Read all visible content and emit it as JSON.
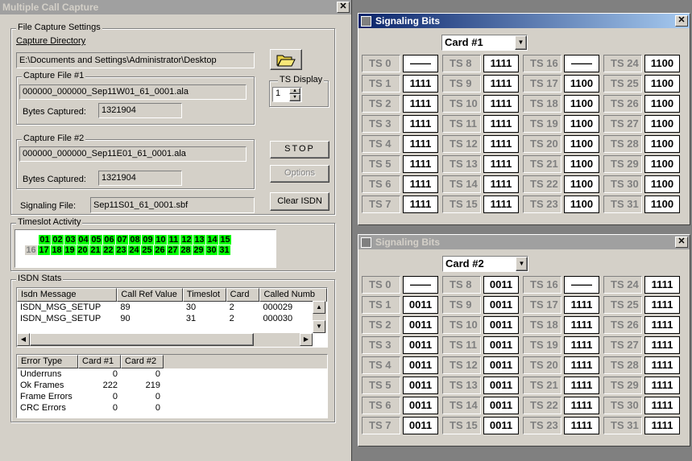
{
  "main": {
    "title": "Multiple Call Capture",
    "file_capture_settings": "File Capture Settings",
    "capture_directory_label": "Capture Directory",
    "capture_directory": "E:\\Documents and Settings\\Administrator\\Desktop",
    "file1_group": "Capture File #1",
    "file1": "000000_000000_Sep11W01_61_0001.ala",
    "bytes_label": "Bytes Captured:",
    "file1_bytes": "1321904",
    "ts_display_label": "TS Display",
    "ts_display_value": "1",
    "file2_group": "Capture File #2",
    "file2": "000000_000000_Sep11E01_61_0001.ala",
    "file2_bytes": "1321904",
    "stop_label": "STOP",
    "options_label": "Options",
    "clear_label": "Clear ISDN",
    "signaling_label": "Signaling File:",
    "signaling_file": "Sep11S01_61_0001.sbf",
    "timeslot_activity": "Timeslot Activity",
    "isdn_stats": "ISDN Stats"
  },
  "timeslots_row1": [
    "01",
    "02",
    "03",
    "04",
    "05",
    "06",
    "07",
    "08",
    "09",
    "10",
    "11",
    "12",
    "13",
    "14",
    "15"
  ],
  "timeslots_row2": [
    "16",
    "17",
    "18",
    "19",
    "20",
    "21",
    "22",
    "23",
    "24",
    "25",
    "26",
    "27",
    "28",
    "29",
    "30",
    "31"
  ],
  "isdn_columns": [
    "Isdn Message",
    "Call Ref Value",
    "Timeslot",
    "Card",
    "Called Numb"
  ],
  "isdn_rows": [
    [
      "ISDN_MSG_SETUP",
      "89",
      "30",
      "2",
      "000029"
    ],
    [
      "ISDN_MSG_SETUP",
      "90",
      "31",
      "2",
      "000030"
    ]
  ],
  "error_columns": [
    "Error Type",
    "Card #1",
    "Card #2"
  ],
  "error_rows": [
    [
      "Underruns",
      "0",
      "0"
    ],
    [
      "Ok Frames",
      "222",
      "219"
    ],
    [
      "Frame Errors",
      "0",
      "0"
    ],
    [
      "CRC Errors",
      "0",
      "0"
    ]
  ],
  "sig1": {
    "title": "Signaling Bits",
    "card": "Card #1",
    "labels": [
      "TS 0",
      "TS 1",
      "TS 2",
      "TS 3",
      "TS 4",
      "TS 5",
      "TS 6",
      "TS 7",
      "TS 8",
      "TS 9",
      "TS 10",
      "TS 11",
      "TS 12",
      "TS 13",
      "TS 14",
      "TS 15",
      "TS 16",
      "TS 17",
      "TS 18",
      "TS 19",
      "TS 20",
      "TS 21",
      "TS 22",
      "TS 23",
      "TS 24",
      "TS 25",
      "TS 26",
      "TS 27",
      "TS 28",
      "TS 29",
      "TS 30",
      "TS 31"
    ],
    "values": [
      "——",
      "1111",
      "1111",
      "1111",
      "1111",
      "1111",
      "1111",
      "1111",
      "1111",
      "1111",
      "1111",
      "1111",
      "1111",
      "1111",
      "1111",
      "1111",
      "——",
      "1100",
      "1100",
      "1100",
      "1100",
      "1100",
      "1100",
      "1100",
      "1100",
      "1100",
      "1100",
      "1100",
      "1100",
      "1100",
      "1100",
      "1100"
    ]
  },
  "sig2": {
    "title": "Signaling Bits",
    "card": "Card #2",
    "labels": [
      "TS 0",
      "TS 1",
      "TS 2",
      "TS 3",
      "TS 4",
      "TS 5",
      "TS 6",
      "TS 7",
      "TS 8",
      "TS 9",
      "TS 10",
      "TS 11",
      "TS 12",
      "TS 13",
      "TS 14",
      "TS 15",
      "TS 16",
      "TS 17",
      "TS 18",
      "TS 19",
      "TS 20",
      "TS 21",
      "TS 22",
      "TS 23",
      "TS 24",
      "TS 25",
      "TS 26",
      "TS 27",
      "TS 28",
      "TS 29",
      "TS 30",
      "TS 31"
    ],
    "values": [
      "——",
      "0011",
      "0011",
      "0011",
      "0011",
      "0011",
      "0011",
      "0011",
      "0011",
      "0011",
      "0011",
      "0011",
      "0011",
      "0011",
      "0011",
      "0011",
      "——",
      "1111",
      "1111",
      "1111",
      "1111",
      "1111",
      "1111",
      "1111",
      "1111",
      "1111",
      "1111",
      "1111",
      "1111",
      "1111",
      "1111",
      "1111"
    ]
  }
}
